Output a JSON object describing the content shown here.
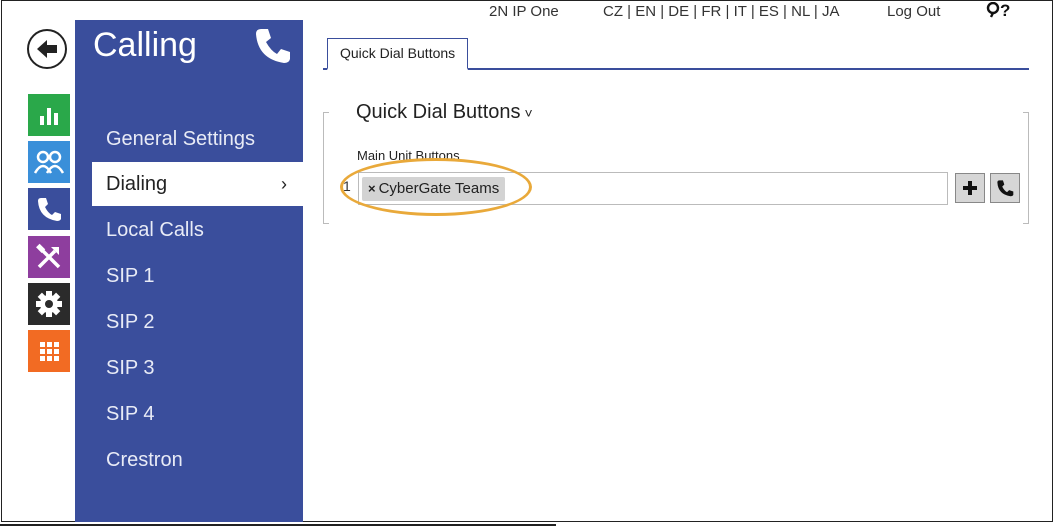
{
  "topbar": {
    "device": "2N IP One",
    "languages": "CZ | EN | DE | FR | IT | ES | NL | JA",
    "logout": "Log Out",
    "extra_icons": "?"
  },
  "sidebar": {
    "title": "Calling",
    "items": [
      {
        "label": "General Settings"
      },
      {
        "label": "Dialing",
        "active": true,
        "chevron": "›"
      },
      {
        "label": "Local Calls"
      },
      {
        "label": "SIP 1"
      },
      {
        "label": "SIP 2"
      },
      {
        "label": "SIP 3"
      },
      {
        "label": "SIP 4"
      },
      {
        "label": "Crestron"
      }
    ]
  },
  "nav_icons": [
    "status-icon",
    "directory-icon",
    "phone-icon",
    "hardware-icon",
    "gear-icon",
    "services-icon"
  ],
  "tabs": [
    {
      "label": "Quick Dial Buttons"
    }
  ],
  "section": {
    "title": "Quick Dial Buttons",
    "caret": "˅",
    "field_label": "Main Unit Buttons",
    "row_number": "1",
    "chip": {
      "remove": "×",
      "label": "CyberGate Teams"
    }
  },
  "colors": {
    "sidebar": "#3a4e9c",
    "highlight": "#e9a93a",
    "status": "#2aa84a",
    "directory": "#3a8fd9",
    "hardware": "#8e3e9e",
    "services": "#f26b23"
  }
}
